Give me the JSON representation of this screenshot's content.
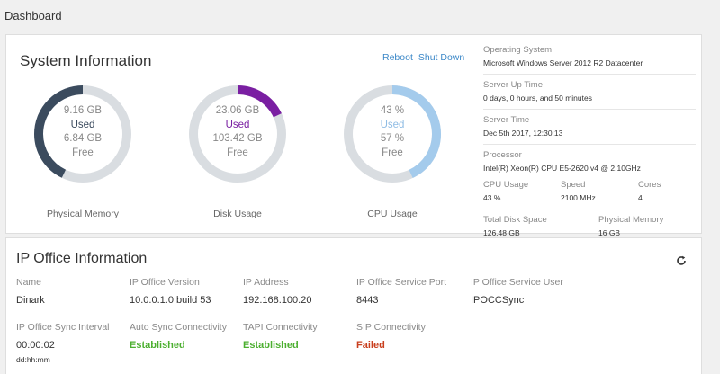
{
  "page": {
    "title": "Dashboard"
  },
  "system": {
    "title": "System Information",
    "reboot_label": "Reboot",
    "shutdown_label": "Shut Down",
    "gauges": [
      {
        "label": "Physical Memory",
        "used_value": "9.16 GB",
        "used_label": "Used",
        "free_value": "6.84 GB",
        "free_label": "Free",
        "fraction_free": 0.43,
        "color": "#3b4b5e"
      },
      {
        "label": "Disk Usage",
        "used_value": "23.06 GB",
        "used_label": "Used",
        "free_value": "103.42 GB",
        "free_label": "Free",
        "fraction_used": 0.18,
        "color": "#7a1fa2"
      },
      {
        "label": "CPU Usage",
        "used_value": "43 %",
        "used_label": "Used",
        "free_value": "57 %",
        "free_label": "Free",
        "fraction_used": 0.43,
        "color": "#a4cbec"
      }
    ],
    "info": {
      "os_label": "Operating System",
      "os_value": "Microsoft Windows Server 2012 R2 Datacenter",
      "uptime_label": "Server Up Time",
      "uptime_value": "0 days, 0 hours, and 50 minutes",
      "time_label": "Server Time",
      "time_value": "Dec 5th 2017, 12:30:13",
      "processor_label": "Processor",
      "processor_value": "Intel(R) Xeon(R) CPU E5-2620 v4 @ 2.10GHz",
      "cpu_usage_label": "CPU Usage",
      "cpu_usage_value": "43 %",
      "speed_label": "Speed",
      "speed_value": "2100 MHz",
      "cores_label": "Cores",
      "cores_value": "4",
      "disk_label": "Total Disk Space",
      "disk_value": "126.48 GB",
      "mem_label": "Physical Memory",
      "mem_value": "16 GB"
    }
  },
  "ipo": {
    "title": "IP Office Information",
    "name_label": "Name",
    "name_value": "Dinark",
    "version_label": "IP Office Version",
    "version_value": "10.0.0.1.0 build 53",
    "address_label": "IP Address",
    "address_value": "192.168.100.20",
    "port_label": "IP Office Service Port",
    "port_value": "8443",
    "user_label": "IP Office Service User",
    "user_value": "IPOCCSync",
    "sync_label": "IP Office Sync Interval",
    "sync_value": "00:00:02",
    "sync_format": "dd:hh:mm",
    "auto_label": "Auto Sync Connectivity",
    "auto_value": "Established",
    "tapi_label": "TAPI Connectivity",
    "tapi_value": "Established",
    "sip_label": "SIP Connectivity",
    "sip_value": "Failed"
  }
}
